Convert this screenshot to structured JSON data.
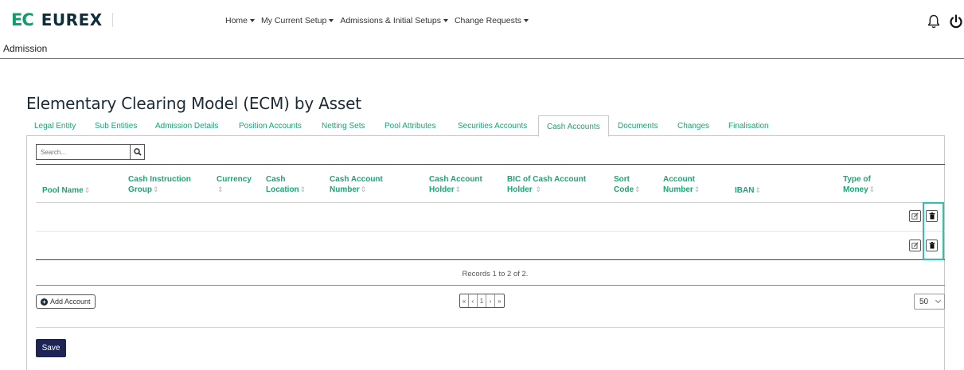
{
  "brand": {
    "mark": "EC",
    "name": "EUREX"
  },
  "nav": [
    {
      "label": "Home"
    },
    {
      "label": "My Current Setup"
    },
    {
      "label": "Admissions & Initial Setups"
    },
    {
      "label": "Change Requests"
    }
  ],
  "breadcrumb": "Admission",
  "page_title": "Elementary Clearing Model (ECM) by Asset",
  "tabs": [
    "Legal Entity",
    "Sub Entities",
    "Admission Details",
    "Position Accounts",
    "Netting Sets",
    "Pool Attributes",
    "Securities Accounts",
    "Cash Accounts",
    "Documents",
    "Changes",
    "Finalisation"
  ],
  "active_tab": "Cash Accounts",
  "search": {
    "placeholder": "Search..."
  },
  "table": {
    "columns": [
      {
        "line1": "Pool Name",
        "line2": ""
      },
      {
        "line1": "Cash Instruction",
        "line2": "Group"
      },
      {
        "line1": "Currency",
        "line2": ""
      },
      {
        "line1": "Cash",
        "line2": "Location"
      },
      {
        "line1": "Cash Account",
        "line2": "Number"
      },
      {
        "line1": "Cash Account",
        "line2": "Holder"
      },
      {
        "line1": "BIC of Cash Account",
        "line2": "Holder"
      },
      {
        "line1": "Sort",
        "line2": "Code"
      },
      {
        "line1": "Account",
        "line2": "Number"
      },
      {
        "line1": "IBAN",
        "line2": ""
      },
      {
        "line1": "Type of",
        "line2": "Money"
      }
    ],
    "sort_glyph": "⇕",
    "row_count": 2
  },
  "records_text": "Records 1 to 2 of 2.",
  "add_account_label": "Add Account",
  "pagination": {
    "first": "«",
    "prev": "‹",
    "current": "1",
    "next": "›",
    "last": "»"
  },
  "page_size": "50",
  "save_label": "Save",
  "colors": {
    "accent": "#1aa576",
    "brand_dark": "#0c2f3a",
    "save_bg": "#1e2554",
    "highlight": "#2fc0a8"
  }
}
